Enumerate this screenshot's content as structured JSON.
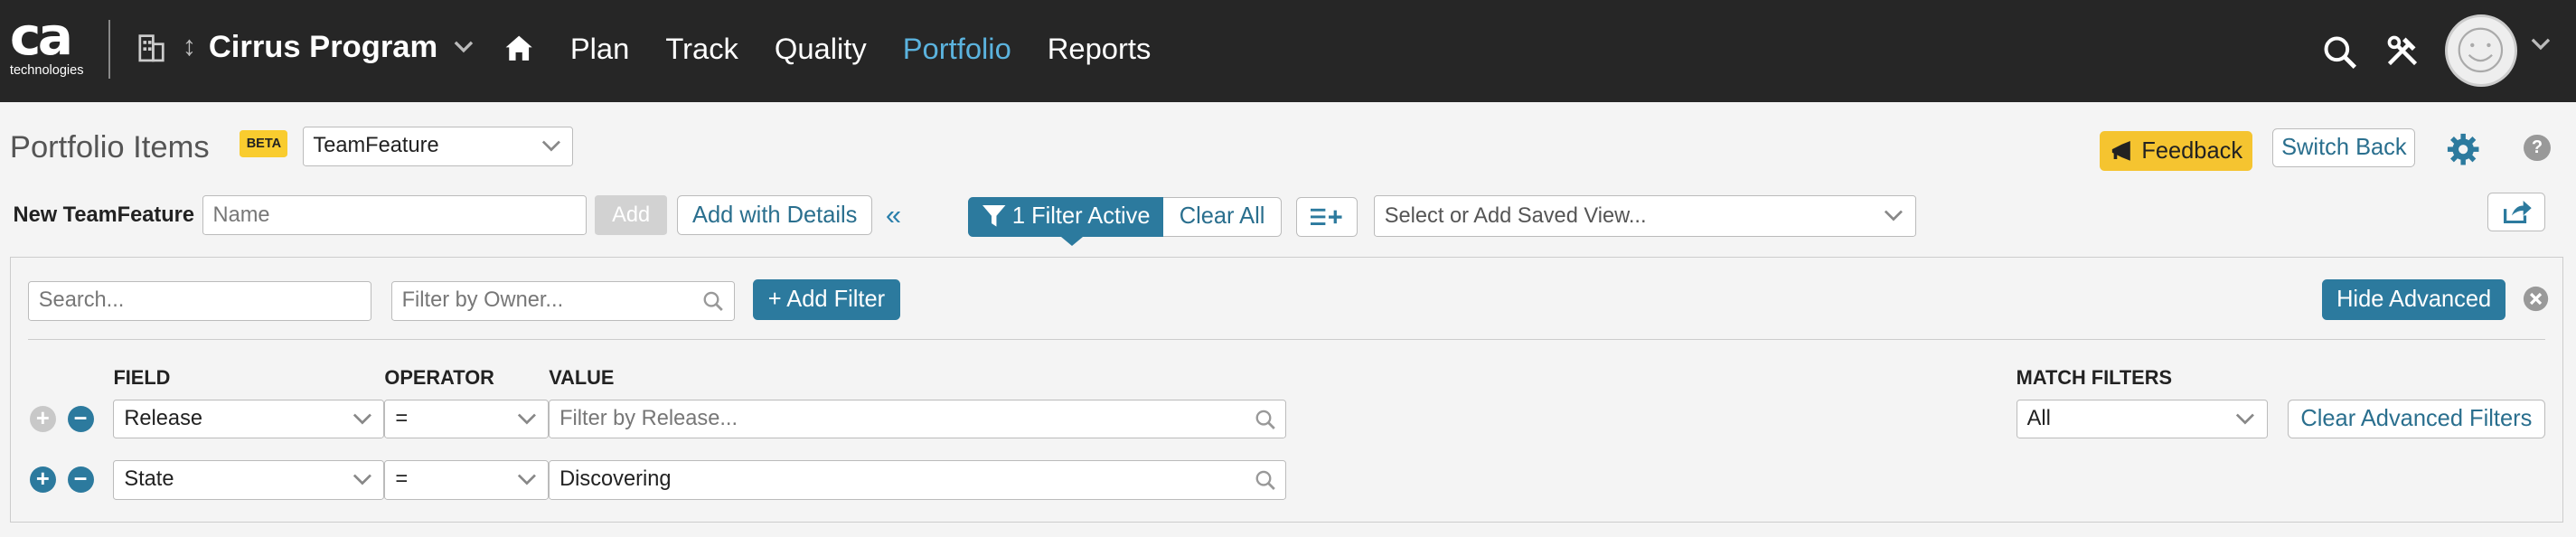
{
  "topbar": {
    "logo_main": "ca",
    "logo_sub": "technologies",
    "program": "Cirrus Program",
    "nav": [
      "Plan",
      "Track",
      "Quality",
      "Portfolio",
      "Reports"
    ],
    "active_nav": "Portfolio"
  },
  "header": {
    "title": "Portfolio Items",
    "beta": "BETA",
    "type_select": "TeamFeature",
    "feedback": "Feedback",
    "switch_back": "Switch Back"
  },
  "toolbar": {
    "new_label": "New TeamFeature",
    "name_placeholder": "Name",
    "add": "Add",
    "add_with_details": "Add with Details",
    "collapse": "«",
    "filter_active": "1 Filter Active",
    "clear_all": "Clear All",
    "saved_view_placeholder": "Select or Add Saved View..."
  },
  "filters": {
    "search_placeholder": "Search...",
    "owner_placeholder": "Filter by Owner...",
    "add_filter": "+ Add Filter",
    "hide_advanced": "Hide Advanced",
    "col_field": "FIELD",
    "col_operator": "OPERATOR",
    "col_value": "VALUE",
    "match_label": "MATCH FILTERS",
    "match_value": "All",
    "clear_advanced": "Clear Advanced Filters",
    "rows": [
      {
        "field": "Release",
        "operator": "=",
        "value": "",
        "value_placeholder": "Filter by Release..."
      },
      {
        "field": "State",
        "operator": "=",
        "value": "Discovering",
        "value_placeholder": ""
      }
    ]
  },
  "colors": {
    "topbar": "#262626",
    "accent": "#2c7a9e",
    "active_nav": "#5bb3de",
    "feedback": "#f5c430"
  }
}
